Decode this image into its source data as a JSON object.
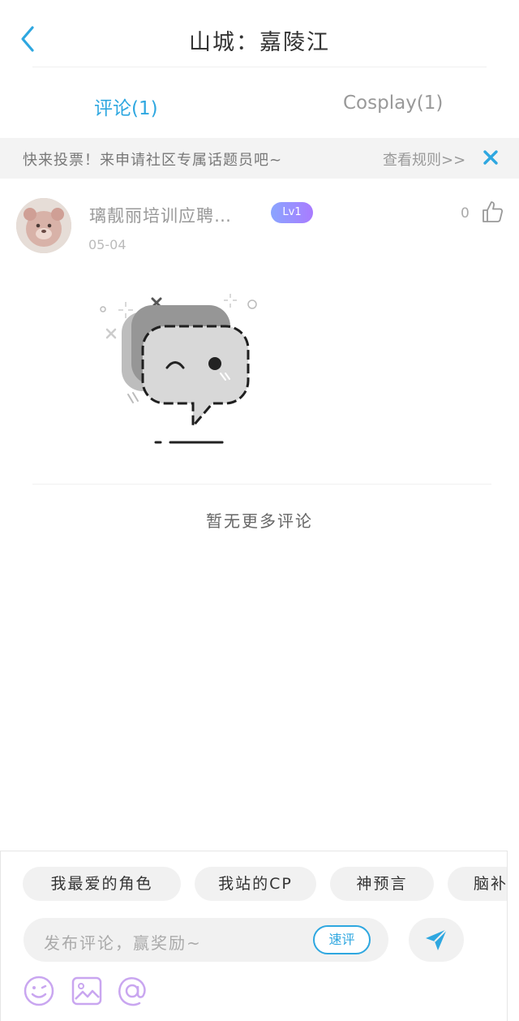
{
  "header": {
    "title": "山城：嘉陵江"
  },
  "tabs": [
    {
      "label": "评论(1)",
      "active": true
    },
    {
      "label": "Cosplay(1)",
      "active": false
    }
  ],
  "notice": {
    "text": "快来投票！来申请社区专属话题员吧~",
    "rules_link": "查看规则>>"
  },
  "comment": {
    "username": "璃靓丽培训应聘…",
    "level": "Lv1",
    "date": "05-04",
    "likes": "0"
  },
  "empty_state": {
    "text": "暂无更多评论"
  },
  "composer": {
    "chips": [
      "我最爱的角色",
      "我站的CP",
      "神预言",
      "脑补"
    ],
    "placeholder": "发布评论，赢奖励~",
    "quick_label": "速评"
  },
  "colors": {
    "accent": "#2ea7e0",
    "badge_gradient_start": "#8aa5ff",
    "badge_gradient_end": "#a97bff",
    "tool_icon": "#c9a6f0"
  },
  "icons": {
    "back": "chevron-left-icon",
    "close": "close-icon",
    "like": "thumbs-up-icon",
    "send": "send-icon",
    "emoji": "smiley-icon",
    "image": "image-icon",
    "mention": "at-icon"
  }
}
